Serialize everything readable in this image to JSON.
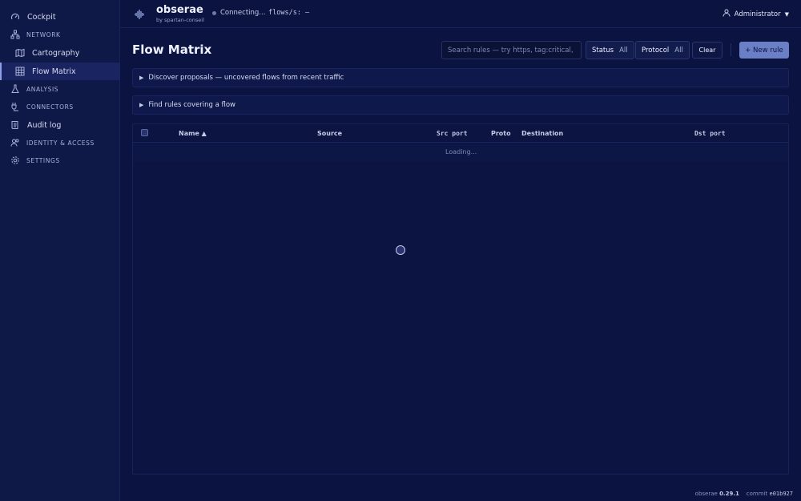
{
  "sidebar": {
    "items": [
      {
        "label": "Cockpit",
        "icon": "gauge-icon"
      },
      {
        "label": "NETWORK",
        "icon": "network-icon"
      },
      {
        "label": "Cartography",
        "icon": "map-icon"
      },
      {
        "label": "Flow Matrix",
        "icon": "grid-icon"
      },
      {
        "label": "ANALYSIS",
        "icon": "flask-icon"
      },
      {
        "label": "CONNECTORS",
        "icon": "plug-icon"
      },
      {
        "label": "Audit log",
        "icon": "scroll-icon"
      },
      {
        "label": "IDENTITY & ACCESS",
        "icon": "users-icon"
      },
      {
        "label": "SETTINGS",
        "icon": "gear-icon"
      }
    ],
    "active_index": 3
  },
  "header": {
    "brand": "obserae",
    "brand_sub": "by spartan-conseil",
    "status": "Connecting...",
    "flows": "flows/s: —",
    "user": "Administrator"
  },
  "main": {
    "title": "Flow Matrix",
    "search_placeholder": "Search rules — try https, tag:critical,",
    "filters": [
      {
        "label": "Status",
        "value": "All"
      },
      {
        "label": "Protocol",
        "value": "All"
      }
    ],
    "clear_label": "Clear",
    "new_rule_label": "+ New rule",
    "panels": [
      "Discover proposals — uncovered flows from recent traffic",
      "Find rules covering a flow"
    ],
    "table": {
      "columns": [
        "Name ▲",
        "Source",
        "Src port",
        "Proto",
        "Destination",
        "Dst port"
      ],
      "loading": "Loading..."
    }
  },
  "footer": {
    "app": "obserae",
    "version": "0.29.1",
    "commit_label": "commit",
    "commit": "e01b927"
  },
  "colors": {
    "background": "#0b1440",
    "sidebar": "#0f1947",
    "accent": "#6b7fc6",
    "text": "#d6dbf2"
  }
}
